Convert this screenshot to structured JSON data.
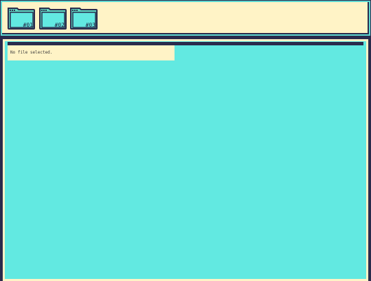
{
  "folders": [
    {
      "label": "#01",
      "icon": "folder-icon"
    },
    {
      "label": "#02",
      "icon": "folder-icon"
    },
    {
      "label": "#03",
      "icon": "folder-icon"
    }
  ],
  "status": {
    "message": "No file selected."
  },
  "colors": {
    "background": "#2a2b4c",
    "top_bar": "#fff3c6",
    "panel": "#62e9e1",
    "folder_fill": "#5fd6c1",
    "ink": "#2a2b4c"
  }
}
